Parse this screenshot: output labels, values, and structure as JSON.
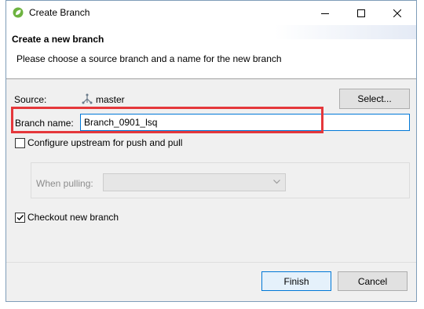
{
  "window": {
    "title": "Create Branch"
  },
  "header": {
    "title": "Create a new branch",
    "description": "Please choose a source branch and a name for the new branch"
  },
  "form": {
    "source_label": "Source:",
    "source_value": "master",
    "select_button": "Select...",
    "branch_name_label": "Branch name:",
    "branch_name_value": "Branch_0901_lsq",
    "upstream_label": "Configure upstream for push and pull",
    "upstream_checked": false,
    "when_pulling_label": "When pulling:",
    "when_pulling_value": "",
    "checkout_label": "Checkout new branch",
    "checkout_checked": true
  },
  "footer": {
    "finish_label": "Finish",
    "cancel_label": "Cancel"
  },
  "colors": {
    "highlight": "#e5373b",
    "focus": "#0078d7",
    "app_icon": "#6db33f"
  },
  "icons": {
    "app": "spring-leaf-icon",
    "source": "branch-icon",
    "minimize": "minimize-icon",
    "maximize": "maximize-icon",
    "close": "close-icon"
  }
}
